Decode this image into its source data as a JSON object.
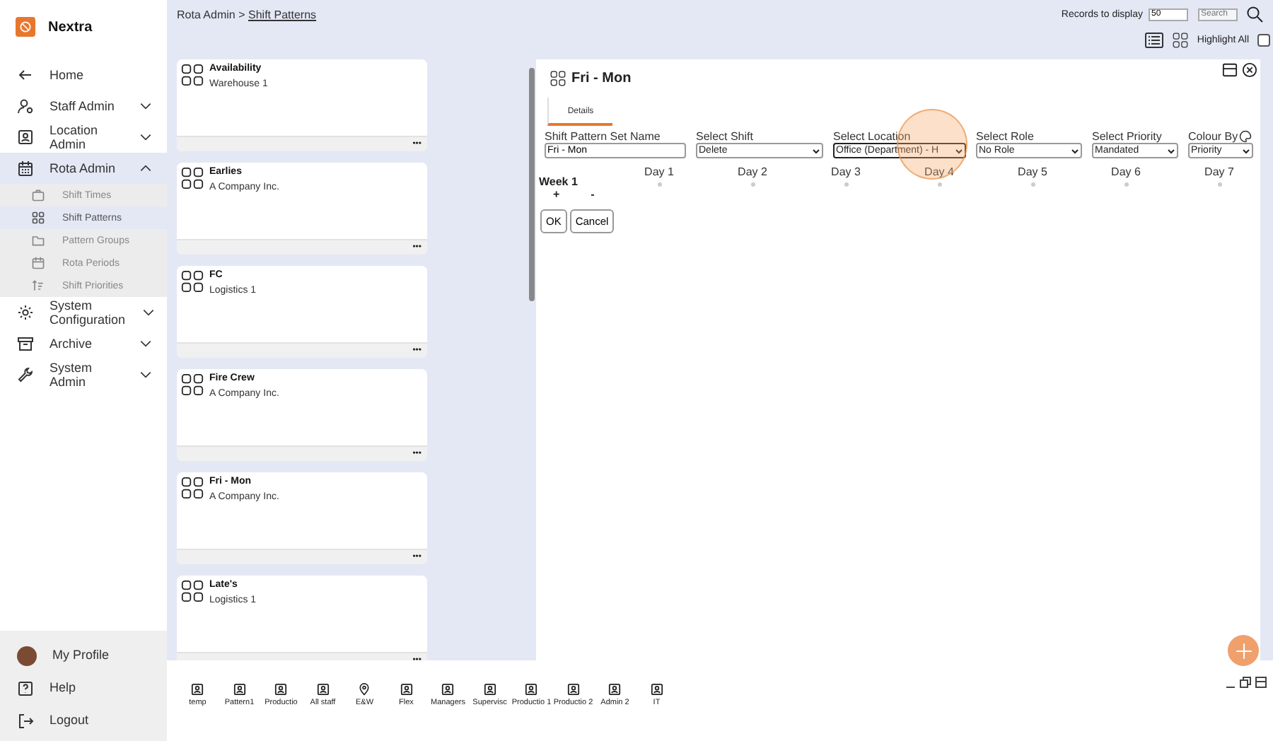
{
  "app": {
    "name": "Nextra"
  },
  "sidebar": {
    "items": [
      {
        "label": "Home",
        "kind": "link"
      },
      {
        "label": "Staff Admin",
        "kind": "group",
        "expanded": false
      },
      {
        "label": "Location Admin",
        "kind": "group",
        "expanded": false
      },
      {
        "label": "Rota Admin",
        "kind": "group",
        "expanded": true,
        "selected": true,
        "children": [
          {
            "label": "Shift Times",
            "selected": false
          },
          {
            "label": "Shift Patterns",
            "selected": true
          },
          {
            "label": "Pattern Groups",
            "selected": false
          },
          {
            "label": "Rota Periods",
            "selected": false
          },
          {
            "label": "Shift Priorities",
            "selected": false
          }
        ]
      },
      {
        "label": "System Configuration",
        "kind": "group",
        "expanded": false
      },
      {
        "label": "Archive",
        "kind": "group",
        "expanded": false
      },
      {
        "label": "System Admin",
        "kind": "group",
        "expanded": false
      }
    ],
    "footer": [
      {
        "label": "My Profile",
        "kind": "profile"
      },
      {
        "label": "Help",
        "kind": "help"
      },
      {
        "label": "Logout",
        "kind": "logout"
      }
    ]
  },
  "breadcrumb": {
    "parent": "Rota Admin",
    "separator": ">",
    "current": "Shift Patterns"
  },
  "toolbar": {
    "records_label": "Records to display",
    "records_value": "50",
    "search": {
      "placeholder": "Search"
    },
    "highlight_all": {
      "label": "Highlight All",
      "checked": false
    }
  },
  "patterns": [
    {
      "title": "Availability",
      "subtitle": "Warehouse 1",
      "menu": "•••"
    },
    {
      "title": "Earlies",
      "subtitle": "A Company Inc.",
      "menu": "•••"
    },
    {
      "title": "FC",
      "subtitle": "Logistics 1",
      "menu": "•••"
    },
    {
      "title": "Fire Crew",
      "subtitle": "A Company Inc.",
      "menu": "•••"
    },
    {
      "title": "Fri - Mon",
      "subtitle": "A Company Inc.",
      "menu": "•••"
    },
    {
      "title": "Late's",
      "subtitle": "Logistics 1",
      "menu": "•••"
    }
  ],
  "detail": {
    "title": "Fri - Mon",
    "tabs": [
      {
        "label": "Details",
        "selected": true
      }
    ],
    "fields": [
      {
        "label": "Shift Pattern Set Name",
        "kind": "text",
        "value": "Fri - Mon"
      },
      {
        "label": "Select Shift",
        "kind": "select",
        "value": "Delete"
      },
      {
        "label": "Select Location",
        "kind": "select",
        "value": "Office (Department) - H",
        "focused": true
      },
      {
        "label": "Select Role",
        "kind": "select",
        "value": "No Role"
      },
      {
        "label": "Select Priority",
        "kind": "select",
        "value": "Mandated"
      },
      {
        "label": "Colour By",
        "kind": "select",
        "value": "Priority",
        "palette": true
      }
    ],
    "days": [
      "Day 1",
      "Day 2",
      "Day 3",
      "Day 4",
      "Day 5",
      "Day 6",
      "Day 7"
    ],
    "week_label": "Week 1",
    "add_week": "+",
    "remove_week": "-",
    "buttons": [
      "OK",
      "Cancel"
    ],
    "tap_indicator": true
  },
  "groups": [
    {
      "label": "temp",
      "kind": "person"
    },
    {
      "label": "Pattern1",
      "kind": "person"
    },
    {
      "label": "Productio",
      "kind": "person"
    },
    {
      "label": "All staff",
      "kind": "person"
    },
    {
      "label": "E&W",
      "kind": "location"
    },
    {
      "label": "Flex",
      "kind": "person"
    },
    {
      "label": "Managers",
      "kind": "person"
    },
    {
      "label": "Supervisc",
      "kind": "person"
    },
    {
      "label": "Productio 1",
      "kind": "person"
    },
    {
      "label": "Productio 2",
      "kind": "person"
    },
    {
      "label": "Admin 2",
      "kind": "person"
    },
    {
      "label": "IT",
      "kind": "person"
    }
  ]
}
